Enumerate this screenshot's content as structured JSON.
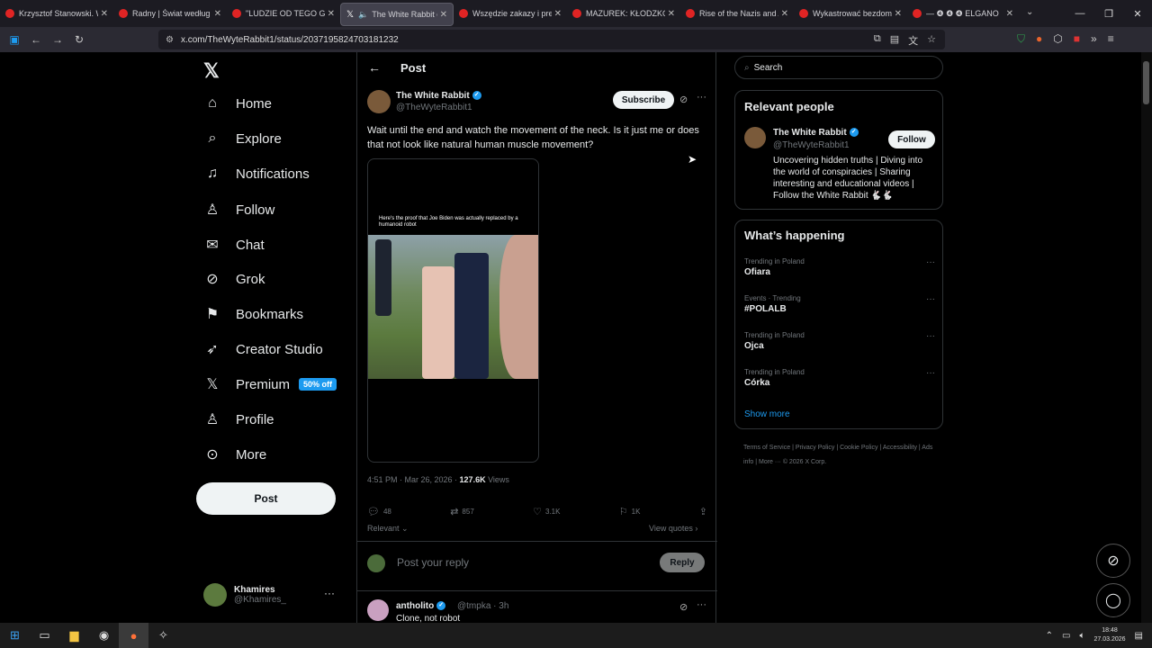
{
  "browser": {
    "tabs": [
      {
        "label": "Krzysztof Stanowski. W ju"
      },
      {
        "label": "Radny | Świat według Kie"
      },
      {
        "label": "\"LUDZIE OD TEGO GŁUPI"
      },
      {
        "label": "The White Rabbit on X"
      },
      {
        "label": "Wszędzie zakazy i preten"
      },
      {
        "label": "MAZUREK: KŁODZKO, PE"
      },
      {
        "label": "Rise of the Nazis and Ad"
      },
      {
        "label": "Wykastrować bezdomno"
      },
      {
        "label": "— ❹ ❹ ❹ ELGANO"
      }
    ],
    "url": "x.com/TheWyteRabbit1/status/2037195824703181232"
  },
  "sidebar": {
    "items": [
      {
        "label": "Home",
        "icon": "home-icon"
      },
      {
        "label": "Explore",
        "icon": "search-icon"
      },
      {
        "label": "Notifications",
        "icon": "bell-icon"
      },
      {
        "label": "Follow",
        "icon": "person-plus-icon"
      },
      {
        "label": "Chat",
        "icon": "mail-icon"
      },
      {
        "label": "Grok",
        "icon": "grok-icon"
      },
      {
        "label": "Bookmarks",
        "icon": "bookmark-icon"
      },
      {
        "label": "Creator Studio",
        "icon": "rocket-icon"
      },
      {
        "label": "Premium",
        "icon": "x-icon"
      },
      {
        "label": "Profile",
        "icon": "person-icon"
      },
      {
        "label": "More",
        "icon": "more-circle-icon"
      }
    ],
    "premium_badge": "50% off",
    "post_button": "Post",
    "account": {
      "name": "Khamires",
      "handle": "@Khamires_"
    }
  },
  "post": {
    "header_title": "Post",
    "author_name": "The White Rabbit",
    "author_handle": "@TheWyteRabbit1",
    "subscribe_label": "Subscribe",
    "text": "Wait until the end and watch the movement of the neck. Is it just me or does that not look like natural human muscle movement?",
    "media_caption": "Here's the proof that Joe Biden was actually replaced by a humanoid robot",
    "time": "4:51 PM · Mar 26, 2026 · ",
    "views_count": "127.6K",
    "views_label": " Views",
    "stats": {
      "replies": "48",
      "reposts": "857",
      "likes": "3.1K",
      "bookmarks": "1K"
    },
    "relevant_label": "Relevant",
    "view_quotes_label": "View quotes",
    "reply_placeholder": "Post your reply",
    "reply_button": "Reply"
  },
  "comment": {
    "name": "antholito",
    "handle": "@tmpka · 3h",
    "text": "Clone, not robot"
  },
  "right": {
    "search_placeholder": "Search",
    "relevant_people_title": "Relevant people",
    "person": {
      "name": "The White Rabbit",
      "handle": "@TheWyteRabbit1",
      "follow_label": "Follow",
      "bio": "Uncovering hidden truths | Diving into the world of conspiracies | Sharing interesting and educational videos | Follow the White Rabbit 🐇🐇"
    },
    "happening_title": "What’s happening",
    "trends": [
      {
        "meta": "Trending in Poland",
        "topic": "Ofiara"
      },
      {
        "meta": "Events · Trending",
        "topic": "#POLALB"
      },
      {
        "meta": "Trending in Poland",
        "topic": "Ojca"
      },
      {
        "meta": "Trending in Poland",
        "topic": "Córka"
      }
    ],
    "show_more": "Show more",
    "footer": "Terms of Service  |  Privacy Policy  |  Cookie Policy  |  Accessibility  |  Ads info  |  More ···  © 2026 X Corp."
  },
  "taskbar": {
    "time": "18:48",
    "date": "27.03.2026"
  },
  "colors": {
    "accent": "#1d9bf0",
    "background": "#000000",
    "border": "#2f3336"
  }
}
